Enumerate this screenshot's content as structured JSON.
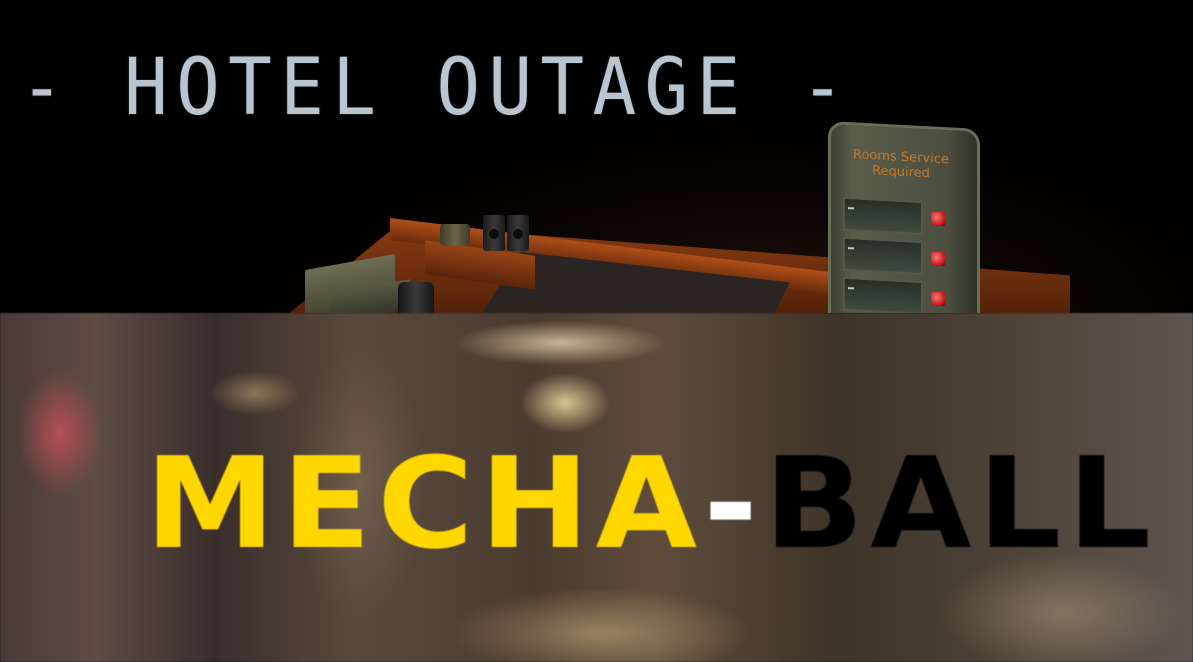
{
  "top_panel": {
    "title": "- HOTEL OUTAGE -",
    "service_board": {
      "title": "Rooms Service Required"
    }
  },
  "bottom_panel": {
    "title_part1": "MECHA",
    "title_dash": "-",
    "title_part2": "BALL",
    "colors": {
      "part1": "#ffd700",
      "dash": "#ffffff",
      "part2": "#000000"
    }
  }
}
